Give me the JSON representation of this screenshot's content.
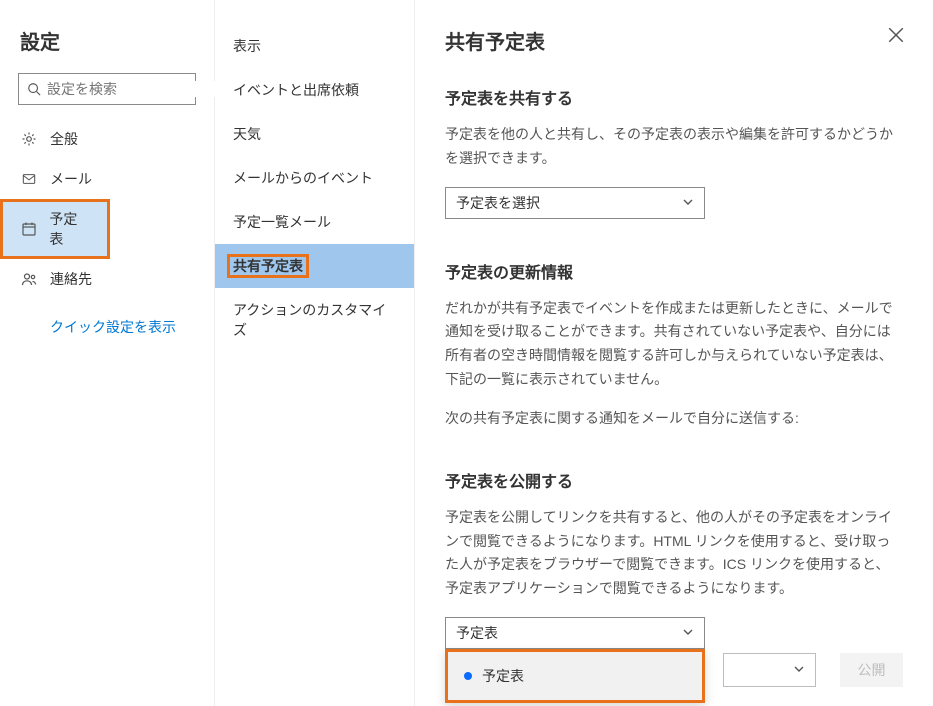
{
  "nav": {
    "title": "設定",
    "search_placeholder": "設定を検索",
    "items": [
      {
        "label": "全般"
      },
      {
        "label": "メール"
      },
      {
        "label": "予定表"
      },
      {
        "label": "連絡先"
      }
    ],
    "quick_link": "クイック設定を表示"
  },
  "sub": {
    "items": [
      {
        "label": "表示"
      },
      {
        "label": "イベントと出席依頼"
      },
      {
        "label": "天気"
      },
      {
        "label": "メールからのイベント"
      },
      {
        "label": "予定一覧メール"
      },
      {
        "label": "共有予定表"
      },
      {
        "label": "アクションのカスタマイズ"
      }
    ]
  },
  "main": {
    "title": "共有予定表",
    "share": {
      "title": "予定表を共有する",
      "desc": "予定表を他の人と共有し、その予定表の表示や編集を許可するかどうかを選択できます。",
      "select_placeholder": "予定表を選択"
    },
    "updates": {
      "title": "予定表の更新情報",
      "desc": "だれかが共有予定表でイベントを作成または更新したときに、メールで通知を受け取ることができます。共有されていない予定表や、自分には所有者の空き時間情報を閲覧する許可しか与えられていない予定表は、下記の一覧に表示されていません。",
      "label": "次の共有予定表に関する通知をメールで自分に送信する:"
    },
    "publish": {
      "title": "予定表を公開する",
      "desc": "予定表を公開してリンクを共有すると、他の人がその予定表をオンラインで閲覧できるようになります。HTML リンクを使用すると、受け取った人が予定表をブラウザーで閲覧できます。ICS リンクを使用すると、予定表アプリケーションで閲覧できるようになります。",
      "select_value": "予定表",
      "option": "予定表",
      "perm_placeholder": "",
      "button": "公開"
    }
  }
}
